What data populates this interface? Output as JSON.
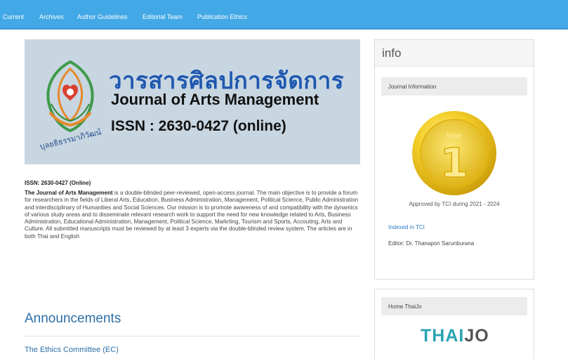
{
  "nav": {
    "items": [
      "Current",
      "Archives",
      "Author Guidelines",
      "Editorial Team",
      "Publication Ethics"
    ]
  },
  "banner": {
    "thai_title": "วารสารศิลปการจัดการ",
    "english_title": "Journal of Arts Management",
    "issn": "ISSN : 2630-0427 (online)",
    "logo_text": "บุลยธิธรรมาภิวัฒน์"
  },
  "about": {
    "issn_line": "ISSN: 2630-0427 (Online)",
    "journal_name": "The Journal of Arts Management",
    "description": " is a double-blinded peer-reviewed, open-access journal. The main objective is to provide a forum for researchers in the fields of Liberal Arts, Education, Business Administration, Management, Political Science, Public Administration and interdisciplinary of Humanities and Social Sciences. Our mission is to promote awareness of and compatibility with the dynamics of various study areas and to disseminate relevant research work to support the need for new knowledge related to Arts, Business Administration, Educational Administration, Management, Political Science, Markrting, Tourism and Sports, Accouting, Arts and Culture. All submitted manuscripts must be reviewed by at least 3 experts via the double-blinded review system. The articles are in both Thai and English"
  },
  "announcements": {
    "heading": "Announcements",
    "items": [
      "The Ethics Committee (EC)"
    ]
  },
  "sidebar": {
    "title": "info",
    "journal_info_heading": "Journal Information",
    "medal_text": "tier",
    "medal_number": "1",
    "approved_text": "Approved by TCI during 2021 - 2024",
    "indexed_link": "Indexed in TCI",
    "editor": "Editor: Dr. Thanapon Sarunburana",
    "home_heading": "Home ThaiJo",
    "thaijo_thai": "THAI",
    "thaijo_jo": "JO"
  },
  "colors": {
    "nav_bg": "#43a8e6",
    "banner_bg": "#c8d6e1",
    "link": "#2d6fa7",
    "medal_gold": "#f1c40f",
    "thaijo_teal": "#2aa3b5",
    "thaijo_dark": "#555555"
  }
}
